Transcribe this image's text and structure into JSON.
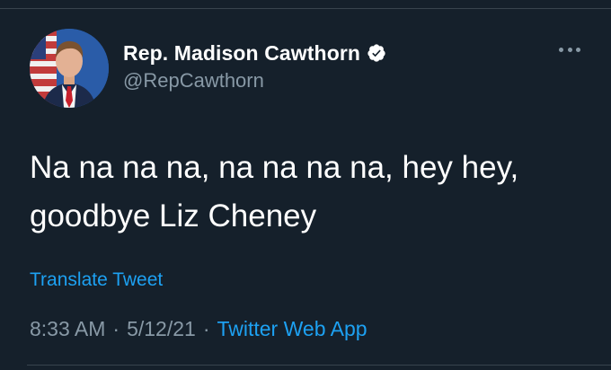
{
  "tweet": {
    "author": {
      "display_name": "Rep. Madison Cawthorn",
      "handle": "@RepCawthorn",
      "verified": true,
      "avatar_icon": "profile-photo"
    },
    "text": "Na na na na, na na na na, hey hey,\ngoodbye Liz Cheney",
    "translate_label": "Translate Tweet",
    "time": "8:33 AM",
    "separator": "·",
    "date": "5/12/21",
    "source": "Twitter Web App",
    "more_icon": "more-dots-icon"
  },
  "colors": {
    "background": "#15202b",
    "primary_text": "#ffffff",
    "secondary_text": "#8899a6",
    "accent": "#1da1f2",
    "divider": "#38444d"
  }
}
